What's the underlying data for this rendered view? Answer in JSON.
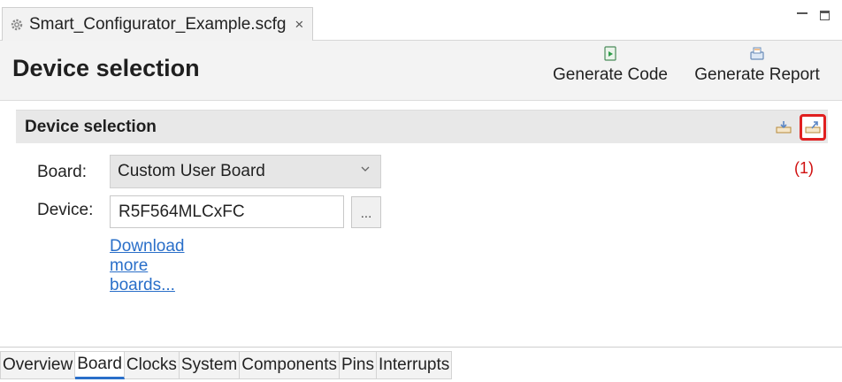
{
  "editor": {
    "file_tab_label": "Smart_Configurator_Example.scfg",
    "close_glyph": "×"
  },
  "header": {
    "title": "Device selection",
    "generate_code_label": "Generate Code",
    "generate_report_label": "Generate Report"
  },
  "section": {
    "title": "Device selection",
    "annotation": "(1)"
  },
  "form": {
    "board_label": "Board:",
    "board_value": "Custom User Board",
    "device_label": "Device:",
    "device_value": "R5F564MLCxFC",
    "browse_label": "...",
    "download_link": "Download more boards..."
  },
  "bottom_tabs": {
    "active": "Board",
    "items": [
      "Overview",
      "Board",
      "Clocks",
      "System",
      "Components",
      "Pins",
      "Interrupts"
    ]
  },
  "icons": {
    "file": "gear-icon",
    "generate_code": "generate-code-icon",
    "generate_report": "generate-report-icon",
    "import": "import-board-icon",
    "export": "export-board-icon",
    "dropdown": "chevron-down-icon",
    "minimize": "minimize-icon",
    "maximize": "maximize-icon"
  },
  "colors": {
    "highlight": "#e02020",
    "link": "#2a6fc9",
    "annotation": "#d01010"
  }
}
